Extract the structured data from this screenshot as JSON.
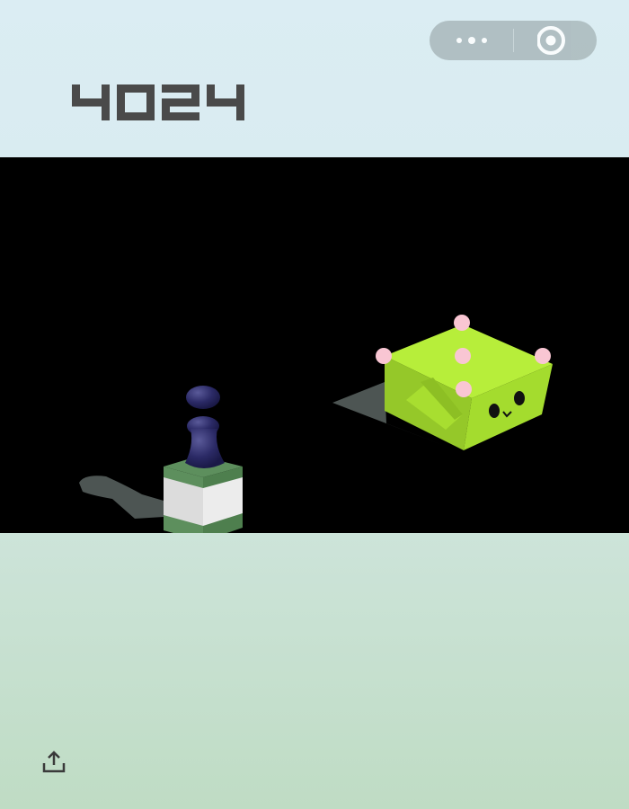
{
  "game": {
    "score": "4024"
  },
  "capsule": {
    "more_icon": "more-dots-icon",
    "close_icon": "target-close-icon"
  },
  "scene": {
    "player": "chess-piece",
    "current_platform": "green-white-box",
    "target_platform": "lime-green-face-box"
  },
  "share": {
    "icon": "share-upload-icon"
  },
  "colors": {
    "background_top": "#dbedf3",
    "background_bottom": "#bfdcc4",
    "score": "#4a4a4a",
    "player": "#2b2a66",
    "target_box": "#b2e834",
    "target_dots": "#f9c6d3"
  }
}
